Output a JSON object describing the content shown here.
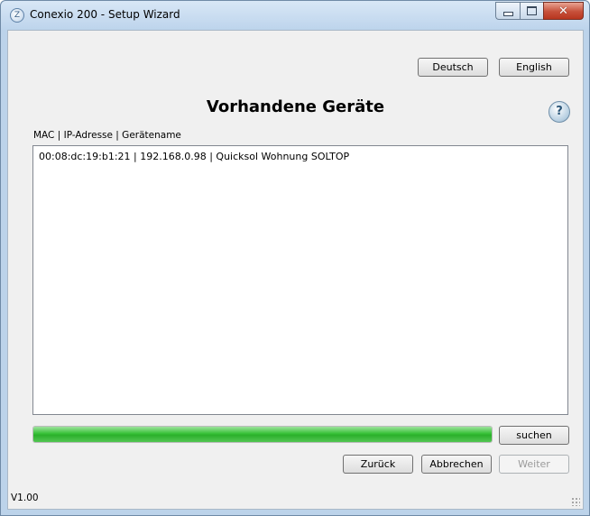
{
  "window": {
    "title": "Conexio 200 - Setup Wizard",
    "icon": "conexio-app-icon",
    "controls": {
      "minimize": "minimize-icon",
      "maximize": "maximize-icon",
      "close_label": "✕"
    }
  },
  "language": {
    "deutsch": "Deutsch",
    "english": "English"
  },
  "heading": "Vorhandene Geräte",
  "help": {
    "label": "?"
  },
  "list": {
    "header": "MAC | IP-Adresse | Gerätename",
    "items": [
      "00:08:dc:19:b1:21 | 192.168.0.98 | Quicksol Wohnung SOLTOP"
    ]
  },
  "progress": {
    "value": 1.0,
    "color": "#2bb02b"
  },
  "buttons": {
    "search": "suchen",
    "back": "Zurück",
    "cancel": "Abbrechen",
    "next": "Weiter"
  },
  "footer": {
    "version": "V1.00"
  }
}
